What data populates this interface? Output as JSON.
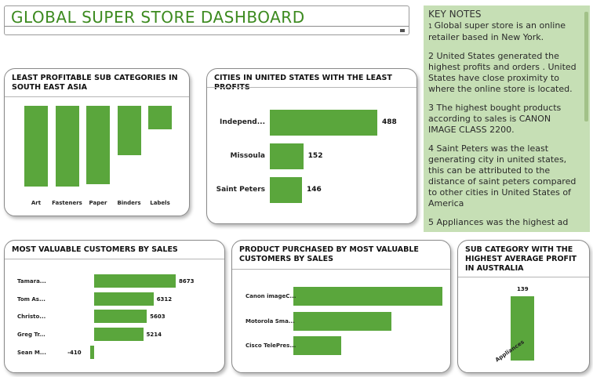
{
  "header": {
    "title": "GLOBAL SUPER STORE DASHBOARD"
  },
  "notes": {
    "title": "KEY NOTES",
    "items": [
      {
        "num": "1",
        "text": "Global super store is an online retailer based in New York."
      },
      {
        "num": "2",
        "text": "United States generated the highest profits and orders . United States have close proximity to where the online store is located."
      },
      {
        "num": "3",
        "text": "The highest bought products according to sales is CANON IMAGE CLASS 2200."
      },
      {
        "num": "4",
        "text": "Saint Peters was the least generating city in united states, this can be attributed to the distance of saint peters compared to other cities in United States of America"
      },
      {
        "num": "5",
        "text": "Appliances was the highest ad"
      }
    ]
  },
  "colors": {
    "bar": "#5aa63c",
    "title": "#3c8a1f",
    "notes_bg": "#c6dfb5"
  },
  "chart_data": [
    {
      "type": "bar",
      "title": "LEAST PROFITABLE SUB CATEGORIES IN SOUTH EAST ASIA",
      "categories": [
        "Art",
        "Fasteners",
        "Paper",
        "Binders",
        "Labels"
      ],
      "values": [
        -103,
        -103,
        -100,
        -63,
        -30
      ]
    },
    {
      "type": "bar",
      "title": "CITIES IN UNITED STATES WITH THE LEAST PROFITS",
      "categories": [
        "Independ...",
        "Missoula",
        "Saint Peters"
      ],
      "values": [
        488,
        152,
        146
      ],
      "value_labels": [
        "488",
        "152",
        "146"
      ]
    },
    {
      "type": "bar",
      "title": "MOST VALUABLE CUSTOMERS BY SALES",
      "categories": [
        "Tamara...",
        "Tom As...",
        "Christo...",
        "Greg Tr...",
        "Sean M..."
      ],
      "values": [
        8673,
        6312,
        5603,
        5214,
        -410
      ],
      "value_labels": [
        "8673",
        "6312",
        "5603",
        "5214",
        "-410"
      ]
    },
    {
      "type": "bar",
      "title": "PRODUCT PURCHASED BY MOST VALUABLE CUSTOMERS BY SALES",
      "categories": [
        "Canon imageC...",
        "Motorola Sma...",
        "Cisco TelePres..."
      ],
      "values": [
        100,
        66,
        32
      ]
    },
    {
      "type": "bar",
      "title": "SUB CATEGORY WITH THE HIGHEST AVERAGE PROFIT IN AUSTRALIA",
      "categories": [
        "Appliances"
      ],
      "values": [
        139
      ],
      "value_labels": [
        "139"
      ]
    }
  ]
}
